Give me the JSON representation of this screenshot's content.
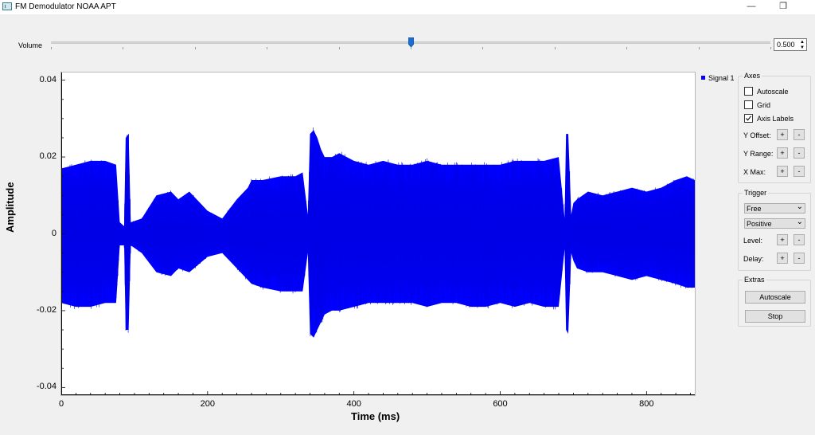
{
  "window": {
    "title": "FM Demodulator NOAA APT",
    "minimize_glyph": "—",
    "maximize_glyph": "❐"
  },
  "volume": {
    "label": "Volume",
    "value": "0.500",
    "level": 0.5
  },
  "plot": {
    "legend": "Signal 1",
    "xlabel": "Time (ms)",
    "ylabel": "Amplitude"
  },
  "axes_group": {
    "title": "Axes",
    "checkboxes": [
      {
        "label": "Autoscale",
        "checked": false
      },
      {
        "label": "Grid",
        "checked": false
      },
      {
        "label": "Axis Labels",
        "checked": true
      }
    ],
    "controls": [
      {
        "label": "Y Offset:",
        "plus": "+",
        "minus": "-"
      },
      {
        "label": "Y Range:",
        "plus": "+",
        "minus": "-"
      },
      {
        "label": "X Max:",
        "plus": "+",
        "minus": "-"
      }
    ]
  },
  "trigger_group": {
    "title": "Trigger",
    "mode": "Free",
    "slope": "Positive",
    "controls": [
      {
        "label": "Level:",
        "plus": "+",
        "minus": "-"
      },
      {
        "label": "Delay:",
        "plus": "+",
        "minus": "-"
      }
    ]
  },
  "extras_group": {
    "title": "Extras",
    "autoscale_label": "Autoscale",
    "stop_label": "Stop"
  },
  "colors": {
    "signal": "#0000ff",
    "background": "#f0f0f0"
  },
  "chart_data": {
    "type": "line",
    "title": "",
    "xlabel": "Time (ms)",
    "ylabel": "Amplitude",
    "xlim": [
      0,
      866
    ],
    "ylim": [
      -0.042,
      0.042
    ],
    "x_ticks": [
      0,
      200,
      400,
      600,
      800
    ],
    "y_ticks": [
      0.04,
      0.02,
      0,
      -0.02,
      -0.04
    ],
    "y_tick_labels": [
      "0.04",
      "0.02",
      "0",
      "-0.02",
      "-0.04"
    ],
    "grid": false,
    "legend_position": "top-right-outside",
    "series": [
      {
        "name": "Signal 1",
        "envelope_x": [
          0,
          20,
          40,
          60,
          75,
          80,
          86,
          88,
          92,
          95,
          110,
          130,
          150,
          160,
          175,
          200,
          220,
          240,
          255,
          260,
          275,
          300,
          320,
          330,
          337,
          340,
          345,
          350,
          355,
          360,
          370,
          380,
          400,
          420,
          440,
          460,
          480,
          500,
          520,
          540,
          560,
          580,
          600,
          620,
          640,
          660,
          680,
          688,
          690,
          693,
          697,
          700,
          705,
          720,
          740,
          760,
          780,
          800,
          820,
          840,
          855,
          866
        ],
        "envelope_max": [
          0.017,
          0.018,
          0.019,
          0.019,
          0.018,
          0.003,
          0.002,
          0.025,
          0.026,
          0.003,
          0.004,
          0.01,
          0.011,
          0.009,
          0.011,
          0.006,
          0.004,
          0.009,
          0.012,
          0.014,
          0.014,
          0.015,
          0.015,
          0.016,
          0.005,
          0.026,
          0.027,
          0.025,
          0.022,
          0.02,
          0.02,
          0.021,
          0.019,
          0.018,
          0.019,
          0.018,
          0.018,
          0.019,
          0.018,
          0.018,
          0.018,
          0.018,
          0.018,
          0.019,
          0.019,
          0.019,
          0.02,
          0.004,
          0.026,
          0.026,
          0.005,
          0.008,
          0.009,
          0.011,
          0.01,
          0.011,
          0.012,
          0.011,
          0.012,
          0.014,
          0.015,
          0.014
        ],
        "envelope_min": [
          -0.018,
          -0.019,
          -0.019,
          -0.018,
          -0.018,
          -0.003,
          -0.003,
          -0.025,
          -0.025,
          -0.003,
          -0.005,
          -0.01,
          -0.011,
          -0.009,
          -0.01,
          -0.006,
          -0.005,
          -0.009,
          -0.012,
          -0.013,
          -0.014,
          -0.015,
          -0.015,
          -0.015,
          -0.005,
          -0.026,
          -0.027,
          -0.025,
          -0.023,
          -0.021,
          -0.02,
          -0.02,
          -0.019,
          -0.018,
          -0.018,
          -0.018,
          -0.018,
          -0.019,
          -0.018,
          -0.018,
          -0.019,
          -0.019,
          -0.018,
          -0.019,
          -0.018,
          -0.019,
          -0.019,
          -0.004,
          -0.025,
          -0.026,
          -0.005,
          -0.007,
          -0.009,
          -0.01,
          -0.01,
          -0.011,
          -0.012,
          -0.011,
          -0.012,
          -0.013,
          -0.014,
          -0.014
        ]
      }
    ]
  }
}
